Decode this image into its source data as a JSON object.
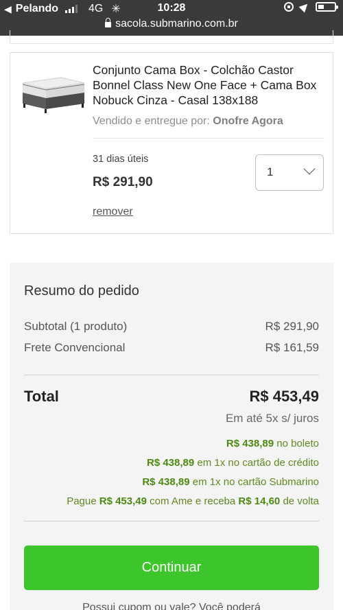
{
  "status_bar": {
    "carrier": "Pelando",
    "network": "4G",
    "time": "10:28",
    "url": "sacola.submarino.com.br"
  },
  "cart_item": {
    "title": "Conjunto Cama Box - Colchão Castor Bonnel Class New One Face + Cama Box Nobuck Cinza - Casal 138x188",
    "seller_prefix": "Vendido e entregue por:",
    "seller_name": "Onofre Agora",
    "delivery_time": "31 dias úteis",
    "price": "R$ 291,90",
    "quantity": "1",
    "remove_label": "remover"
  },
  "summary": {
    "heading": "Resumo do pedido",
    "subtotal_label": "Subtotal (1 produto)",
    "subtotal_value": "R$ 291,90",
    "shipping_label": "Frete Convencional",
    "shipping_value": "R$ 161,59",
    "total_label": "Total",
    "total_value": "R$ 453,49",
    "installments": "Em até 5x s/ juros",
    "options": [
      {
        "amount": "R$ 438,89",
        "text": "no boleto"
      },
      {
        "amount": "R$ 438,89",
        "text": "em 1x no cartão de crédito"
      },
      {
        "amount": "R$ 438,89",
        "text": "em 1x no cartão Submarino"
      }
    ],
    "ame": {
      "prefix": "Pague",
      "amount": "R$ 453,49",
      "middle": "com Ame e receba",
      "cashback": "R$ 14,60",
      "suffix": "de volta"
    },
    "continue_label": "Continuar",
    "footer_text": "Possui cupom ou vale? Você poderá"
  },
  "colors": {
    "status_bar": "#3a3a3a",
    "button_green": "#3dc62b",
    "price_green": "#4d8a12"
  }
}
